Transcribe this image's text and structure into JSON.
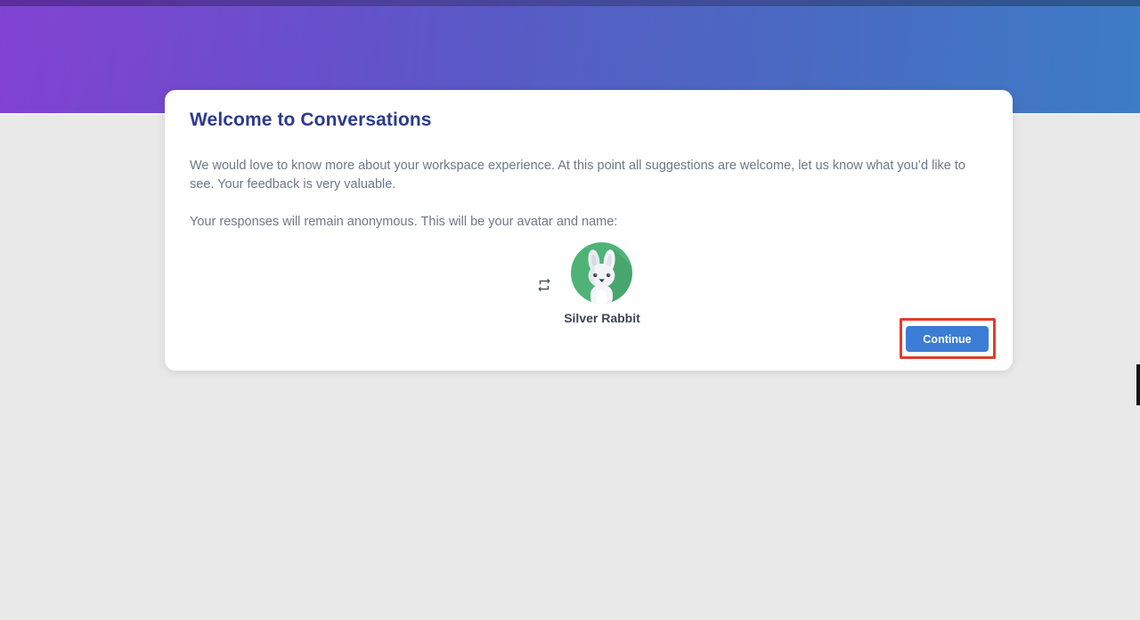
{
  "modal": {
    "title": "Welcome to Conversations",
    "paragraph1": "We would love to know more about your workspace experience. At this point all suggestions are welcome, let us know what you’d like to see. Your feedback is very valuable.",
    "paragraph2": "Your responses will remain anonymous. This will be your avatar and name:",
    "avatar_name": "Silver Rabbit",
    "continue_label": "Continue"
  },
  "icons": {
    "refresh": "refresh-cycle-icon",
    "avatar": "rabbit-avatar"
  },
  "colors": {
    "page_bg": "#e9e9e9",
    "banner_left": "#7b38d0",
    "banner_mid": "#5560c6",
    "banner_right": "#3f80cc",
    "banner_top_left": "#5b2c9d",
    "banner_top_right": "#29588c",
    "title": "#2c3a8e",
    "body_text": "#6d7886",
    "avatar_green": "#4fb377",
    "avatar_shadow_green": "#43a169",
    "name_text": "#3d4654",
    "button_bg": "#3b7cd5",
    "button_text": "#ffffff",
    "annotation_red": "#e23b2c"
  }
}
